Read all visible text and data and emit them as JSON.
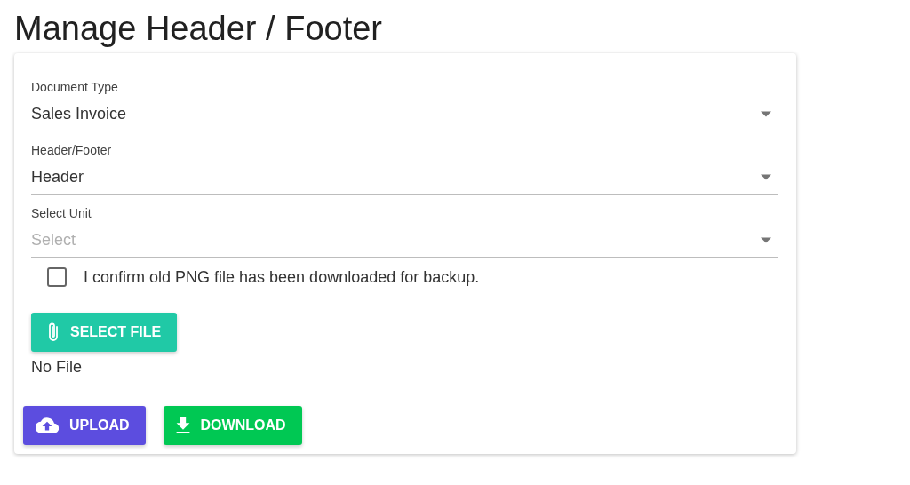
{
  "title": "Manage Header / Footer",
  "fields": [
    {
      "label": "Document Type",
      "value": "Sales Invoice"
    },
    {
      "label": "Header/Footer",
      "value": "Header"
    },
    {
      "label": "Select Unit",
      "placeholder": "Select"
    }
  ],
  "confirm": {
    "label": "I confirm old PNG file has been downloaded for backup.",
    "checked": false
  },
  "file_button": {
    "label": "SELECT FILE",
    "kind": "attach",
    "color": "#20c9a6"
  },
  "file_status": "No File",
  "actions": [
    {
      "label": "UPLOAD",
      "kind": "upload",
      "color": "#5c4ddf"
    },
    {
      "label": "DOWNLOAD",
      "kind": "download",
      "color": "#00c853"
    }
  ]
}
